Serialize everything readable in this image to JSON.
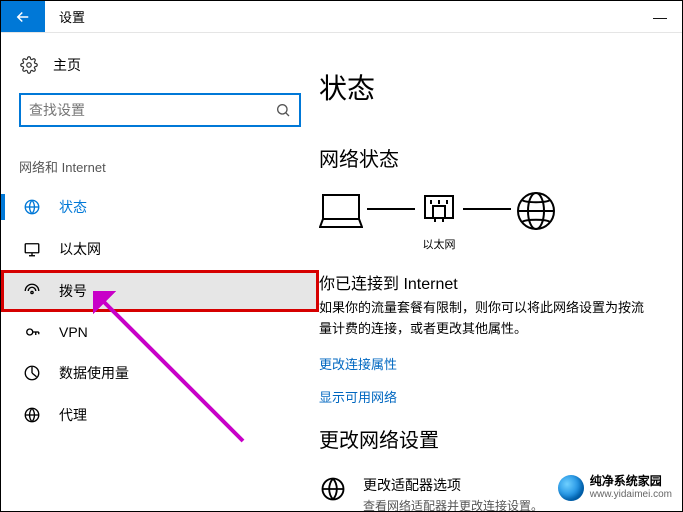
{
  "window": {
    "title": "设置",
    "minimize": "—"
  },
  "sidebar": {
    "home": "主页",
    "search_placeholder": "查找设置",
    "section": "网络和 Internet",
    "items": [
      {
        "key": "status",
        "label": "状态"
      },
      {
        "key": "ethernet",
        "label": "以太网"
      },
      {
        "key": "dialup",
        "label": "拨号"
      },
      {
        "key": "vpn",
        "label": "VPN"
      },
      {
        "key": "data",
        "label": "数据使用量"
      },
      {
        "key": "proxy",
        "label": "代理"
      }
    ]
  },
  "main": {
    "h1": "状态",
    "h2_network": "网络状态",
    "diagram": {
      "ethernet_label": "以太网"
    },
    "connected": "你已连接到 Internet",
    "desc": "如果你的流量套餐有限制，则你可以将此网络设置为按流量计费的连接，或者更改其他属性。",
    "link_change_props": "更改连接属性",
    "link_show_networks": "显示可用网络",
    "h2_change": "更改网络设置",
    "adapter_title": "更改适配器选项",
    "adapter_sub": "查看网络适配器并更改连接设置。"
  },
  "watermark": {
    "line1": "纯净系统家园",
    "line2": "www.yidaimei.com"
  }
}
